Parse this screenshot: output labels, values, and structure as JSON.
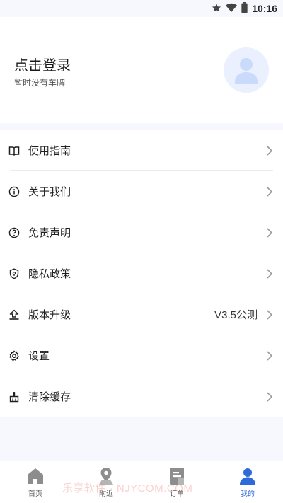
{
  "status_bar": {
    "time": "10:16",
    "icons": [
      "star-icon",
      "wifi-icon",
      "battery-icon"
    ]
  },
  "profile": {
    "login_label": "点击登录",
    "plate_status": "暂时没有车牌",
    "avatar_icon": "user-avatar-icon"
  },
  "menu": {
    "items": [
      {
        "label": "使用指南",
        "icon": "book-icon",
        "value": ""
      },
      {
        "label": "关于我们",
        "icon": "info-icon",
        "value": ""
      },
      {
        "label": "免责声明",
        "icon": "question-icon",
        "value": ""
      },
      {
        "label": "隐私政策",
        "icon": "shield-icon",
        "value": ""
      },
      {
        "label": "版本升级",
        "icon": "upgrade-icon",
        "value": "V3.5公测"
      },
      {
        "label": "设置",
        "icon": "gear-icon",
        "value": ""
      },
      {
        "label": "清除缓存",
        "icon": "broom-icon",
        "value": ""
      }
    ]
  },
  "tabbar": {
    "tabs": [
      {
        "label": "首页",
        "icon": "home-icon",
        "active": false
      },
      {
        "label": "附近",
        "icon": "location-icon",
        "active": false
      },
      {
        "label": "订单",
        "icon": "order-icon",
        "active": false
      },
      {
        "label": "我的",
        "icon": "user-icon",
        "active": true
      }
    ]
  },
  "colors": {
    "accent": "#2f6bd8",
    "background": "#f6f8fd",
    "avatar_bg": "#eaf0fd"
  },
  "watermark": "乐享软件 · NJYCOM.COM"
}
